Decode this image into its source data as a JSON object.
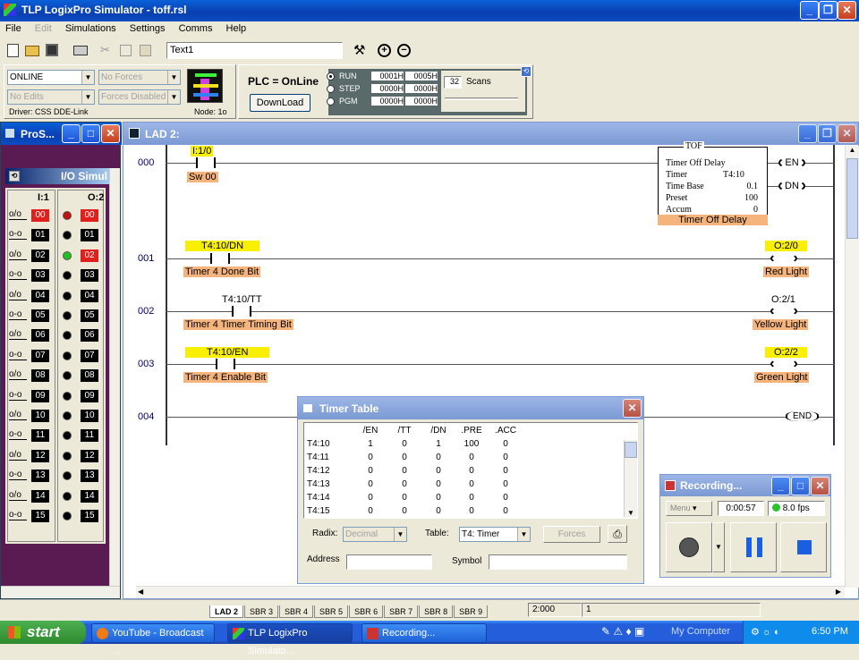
{
  "app": {
    "title": "TLP LogixPro Simulator  -  toff.rsl"
  },
  "menu": [
    "File",
    "Edit",
    "Simulations",
    "Settings",
    "Comms",
    "Help"
  ],
  "toolbar": {
    "text_field": "Text1"
  },
  "status": {
    "mode": "ONLINE",
    "forces": "No Forces",
    "edits": "No Edits",
    "forces_disabled": "Forces Disabled",
    "driver": "Driver: CSS DDE-Link",
    "node": "Node: 1o",
    "plc": "PLC = OnLine",
    "download": "DownLoad",
    "run": "RUN",
    "step": "STEP",
    "pgm": "PGM",
    "reg1": "0001H",
    "reg2": "0005H",
    "reg3": "0000H",
    "reg4": "0000H",
    "reg5": "0000H",
    "reg6": "0000H",
    "scans_value": "32",
    "scans_label": "Scans"
  },
  "pro_window": {
    "title": "ProS..."
  },
  "io_sim": {
    "title": "I/O Simul",
    "input_header": "I:1",
    "output_header": "O:2",
    "labels": [
      "00",
      "01",
      "02",
      "03",
      "04",
      "05",
      "06",
      "07",
      "08",
      "09",
      "10",
      "11",
      "12",
      "13",
      "14",
      "15"
    ]
  },
  "lad": {
    "title": "LAD 2:",
    "rungs": [
      {
        "num": "000",
        "addr": "I:1/0",
        "desc": "Sw 00"
      },
      {
        "num": "001",
        "addr": "T4:10/DN",
        "desc": "Timer 4 Done Bit",
        "coil_addr": "O:2/0",
        "coil_desc": "Red Light"
      },
      {
        "num": "002",
        "addr": "T4:10/TT",
        "desc": "Timer 4 Timer Timing Bit",
        "coil_addr": "O:2/1",
        "coil_desc": "Yellow Light"
      },
      {
        "num": "003",
        "addr": "T4:10/EN",
        "desc": "Timer 4 Enable Bit",
        "coil_addr": "O:2/2",
        "coil_desc": "Green Light"
      },
      {
        "num": "004",
        "end": "END"
      }
    ],
    "tof": {
      "type": "TOF",
      "name": "Timer Off Delay",
      "timer_label": "Timer",
      "timer": "T4:10",
      "base_label": "Time Base",
      "base": "0.1",
      "preset_label": "Preset",
      "preset": "100",
      "accum_label": "Accum",
      "accum": "0",
      "desc": "Timer Off Delay",
      "en": "EN",
      "dn": "DN"
    }
  },
  "timer_table": {
    "title": "Timer Table",
    "headers": [
      "/EN",
      "/TT",
      "/DN",
      ".PRE",
      ".ACC"
    ],
    "rows": [
      {
        "name": "T4:10",
        "en": "1",
        "tt": "0",
        "dn": "1",
        "pre": "100",
        "acc": "0"
      },
      {
        "name": "T4:11",
        "en": "0",
        "tt": "0",
        "dn": "0",
        "pre": "0",
        "acc": "0"
      },
      {
        "name": "T4:12",
        "en": "0",
        "tt": "0",
        "dn": "0",
        "pre": "0",
        "acc": "0"
      },
      {
        "name": "T4:13",
        "en": "0",
        "tt": "0",
        "dn": "0",
        "pre": "0",
        "acc": "0"
      },
      {
        "name": "T4:14",
        "en": "0",
        "tt": "0",
        "dn": "0",
        "pre": "0",
        "acc": "0"
      },
      {
        "name": "T4:15",
        "en": "0",
        "tt": "0",
        "dn": "0",
        "pre": "0",
        "acc": "0"
      }
    ],
    "radix_label": "Radix:",
    "radix": "Decimal",
    "table_label": "Table:",
    "table": "T4: Timer",
    "forces": "Forces",
    "address_label": "Address",
    "symbol_label": "Symbol"
  },
  "recording": {
    "title": "Recording...",
    "menu": "Menu",
    "time": "0:00:57",
    "fps": "8.0 fps"
  },
  "tabs": [
    "LAD 2",
    "SBR 3",
    "SBR 4",
    "SBR 5",
    "SBR 6",
    "SBR 7",
    "SBR 8",
    "SBR 9"
  ],
  "statusbar": {
    "pos": "2:000",
    "col": "1"
  },
  "taskbar": {
    "start": "start",
    "items": [
      "YouTube - Broadcast ...",
      "TLP LogixPro Simulato...",
      "Recording..."
    ],
    "mycomputer": "My Computer",
    "clock": "6:50 PM"
  }
}
